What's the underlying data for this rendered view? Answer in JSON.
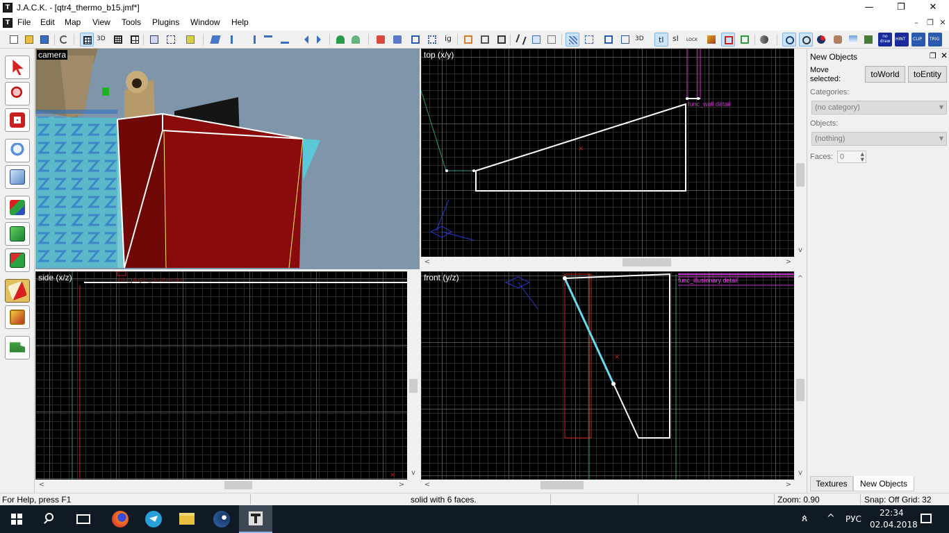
{
  "window": {
    "title": "J.A.C.K. - [qtr4_thermo_b15.jmf*]",
    "minimize": "—",
    "restore": "❐",
    "close": "✕",
    "app_icon": "T"
  },
  "menu": {
    "items": [
      "File",
      "Edit",
      "Map",
      "View",
      "Tools",
      "Plugins",
      "Window",
      "Help"
    ],
    "mdi_min": "–",
    "mdi_restore": "❐",
    "mdi_close": "✕"
  },
  "toolbar": {
    "labels": [
      "3D",
      "ig",
      "3D",
      "tl",
      "sl",
      "LOCK",
      "no draw",
      "HINT",
      "CLIP",
      "TRIG"
    ]
  },
  "viewports": {
    "camera": "camera",
    "top": "top (x/y)",
    "side": "side (x/z)",
    "front": "front (y/z)"
  },
  "map_labels": {
    "top_entity": "func_wall detail",
    "side_entity": "info_player_deathmatch",
    "front_entity": "func_illusionary detail"
  },
  "panel": {
    "title": "New Objects",
    "move_selected": "Move selected:",
    "to_world": "toWorld",
    "to_entity": "toEntity",
    "categories_label": "Categories:",
    "categories_value": "(no category)",
    "objects_label": "Objects:",
    "objects_value": "(nothing)",
    "faces_label": "Faces:",
    "faces_value": "0",
    "tabs": [
      "Textures",
      "New Objects"
    ]
  },
  "status": {
    "help": "For Help, press F1",
    "selection": "solid with 6 faces.",
    "zoom": "Zoom: 0.90",
    "snap": "Snap: Off Grid: 32"
  },
  "taskbar": {
    "lang": "РУС",
    "time": "22:34",
    "date": "02.04.2018"
  },
  "colors": {
    "viewport_bg": "#000000",
    "selection": "#ffffff",
    "entity": "#cc33cc",
    "camera_sky": "#7f95aa",
    "brush_red": "#8a0b0b",
    "taskbar": "#101a24"
  }
}
